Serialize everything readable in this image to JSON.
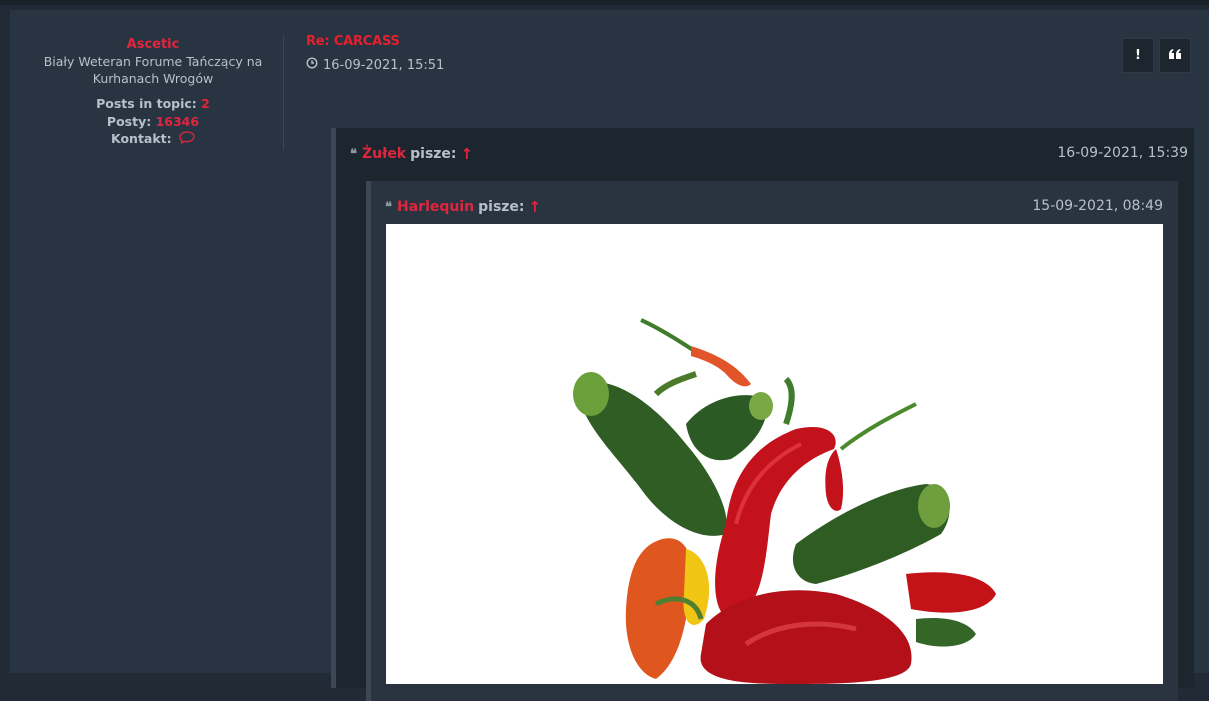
{
  "post": {
    "author": "Ascetic",
    "rank": "Biały Weteran Forume Tańczący na Kurhanach Wrogów",
    "stats": [
      {
        "label": "Posts in topic:",
        "value": "2"
      },
      {
        "label": "Posty:",
        "value": "16346"
      }
    ],
    "contact_label": "Kontakt:",
    "title": "Re: CARCASS",
    "date": "16-09-2021, 15:51",
    "buttons": {
      "report": "!",
      "quote": "❝"
    }
  },
  "quote1": {
    "author": "Żułek",
    "said": "pisze:",
    "arrow": "↑",
    "date": "16-09-2021, 15:39"
  },
  "quote2": {
    "author": "Harlequin",
    "said": "pisze:",
    "arrow": "↑",
    "date": "15-09-2021, 08:49"
  },
  "icons": [
    "clock-icon",
    "comment-icon",
    "exclamation-icon",
    "quote-icon"
  ],
  "colors": {
    "accent": "#e0263e",
    "title": "#e51f2f",
    "bg": "#222b35",
    "panel": "#283441",
    "quote": "#1d252e"
  }
}
